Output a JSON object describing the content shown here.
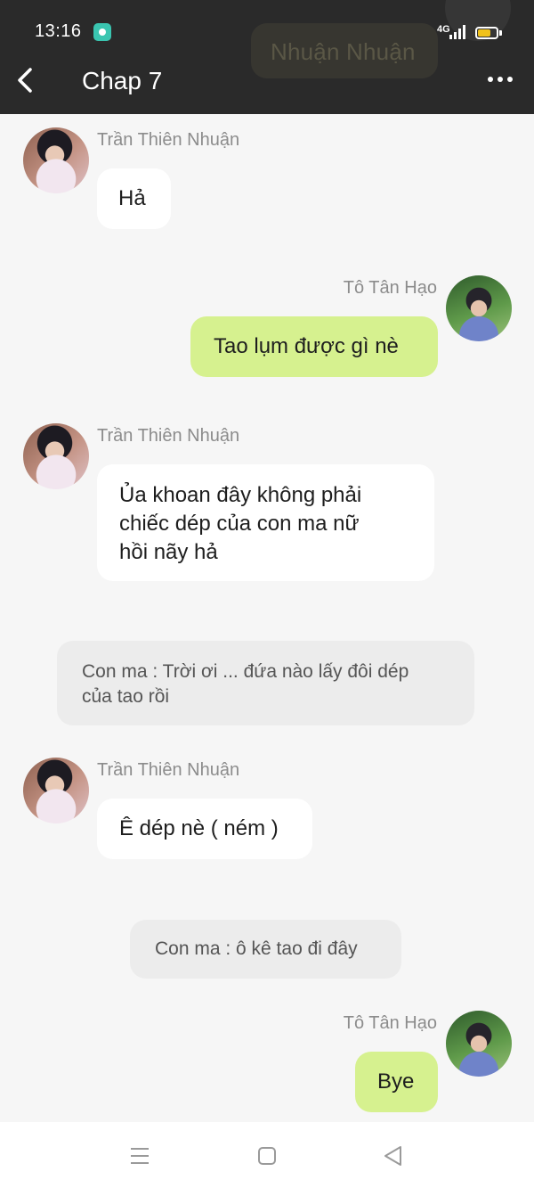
{
  "status_bar": {
    "time": "13:16",
    "network": "4G"
  },
  "header": {
    "title": "Chap 7",
    "background_message": "Nhuận Nhuận"
  },
  "messages": [
    {
      "sender": "Trần Thiên Nhuận",
      "text": "Hả"
    },
    {
      "sender": "Tô Tân Hạo",
      "text": "Tao lụm được gì nè"
    },
    {
      "sender": "Trần Thiên Nhuận",
      "lines": [
        "Ủa khoan đây không phải",
        "chiếc dép của con ma nữ",
        "hồi nãy hả"
      ]
    },
    {
      "system_lines": [
        "Con ma : Trời ơi ... đứa nào lấy đôi dép",
        "của tao rồi"
      ]
    },
    {
      "sender": "Trần Thiên Nhuận",
      "text": "Ê dép nè ( ném )"
    },
    {
      "system": "Con ma : ô kê tao đi đây"
    },
    {
      "sender": "Tô Tân Hạo",
      "text": "Bye"
    }
  ],
  "colors": {
    "header_bg": "#2a2a2a",
    "chat_bg": "#f6f6f6",
    "my_bubble": "#d6f18f",
    "their_bubble": "#ffffff",
    "system_bubble": "#ececec",
    "battery": "#f1c21b"
  }
}
